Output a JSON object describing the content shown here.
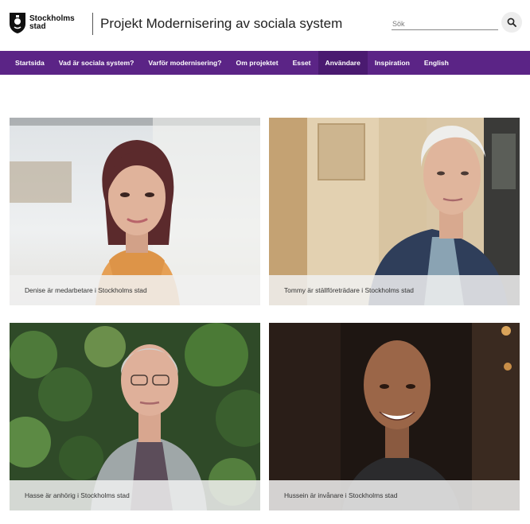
{
  "header": {
    "logo_line1": "Stockholms",
    "logo_line2": "stad",
    "site_title": "Projekt Modernisering av sociala system",
    "search_placeholder": "Sök",
    "search_icon": "search-icon",
    "logo_icon": "coat-of-arms-icon"
  },
  "nav": {
    "items": [
      {
        "label": "Startsida"
      },
      {
        "label": "Vad är sociala system?"
      },
      {
        "label": "Varför modernisering?"
      },
      {
        "label": "Om projektet"
      },
      {
        "label": "Esset"
      },
      {
        "label": "Användare"
      },
      {
        "label": "Inspiration"
      },
      {
        "label": "English"
      }
    ],
    "active_label": "Användare"
  },
  "cards": [
    {
      "caption": "Denise är medarbetare i Stockholms stad"
    },
    {
      "caption": "Tommy är ställföreträdare i Stockholms stad"
    },
    {
      "caption": "Hasse är anhörig i Stockholms stad"
    },
    {
      "caption": "Hussein är invånare i Stockholms stad"
    }
  ],
  "colors": {
    "nav_background": "#5b2486",
    "nav_active": "#4a1a70",
    "caption_background": "#f0f0f0"
  }
}
